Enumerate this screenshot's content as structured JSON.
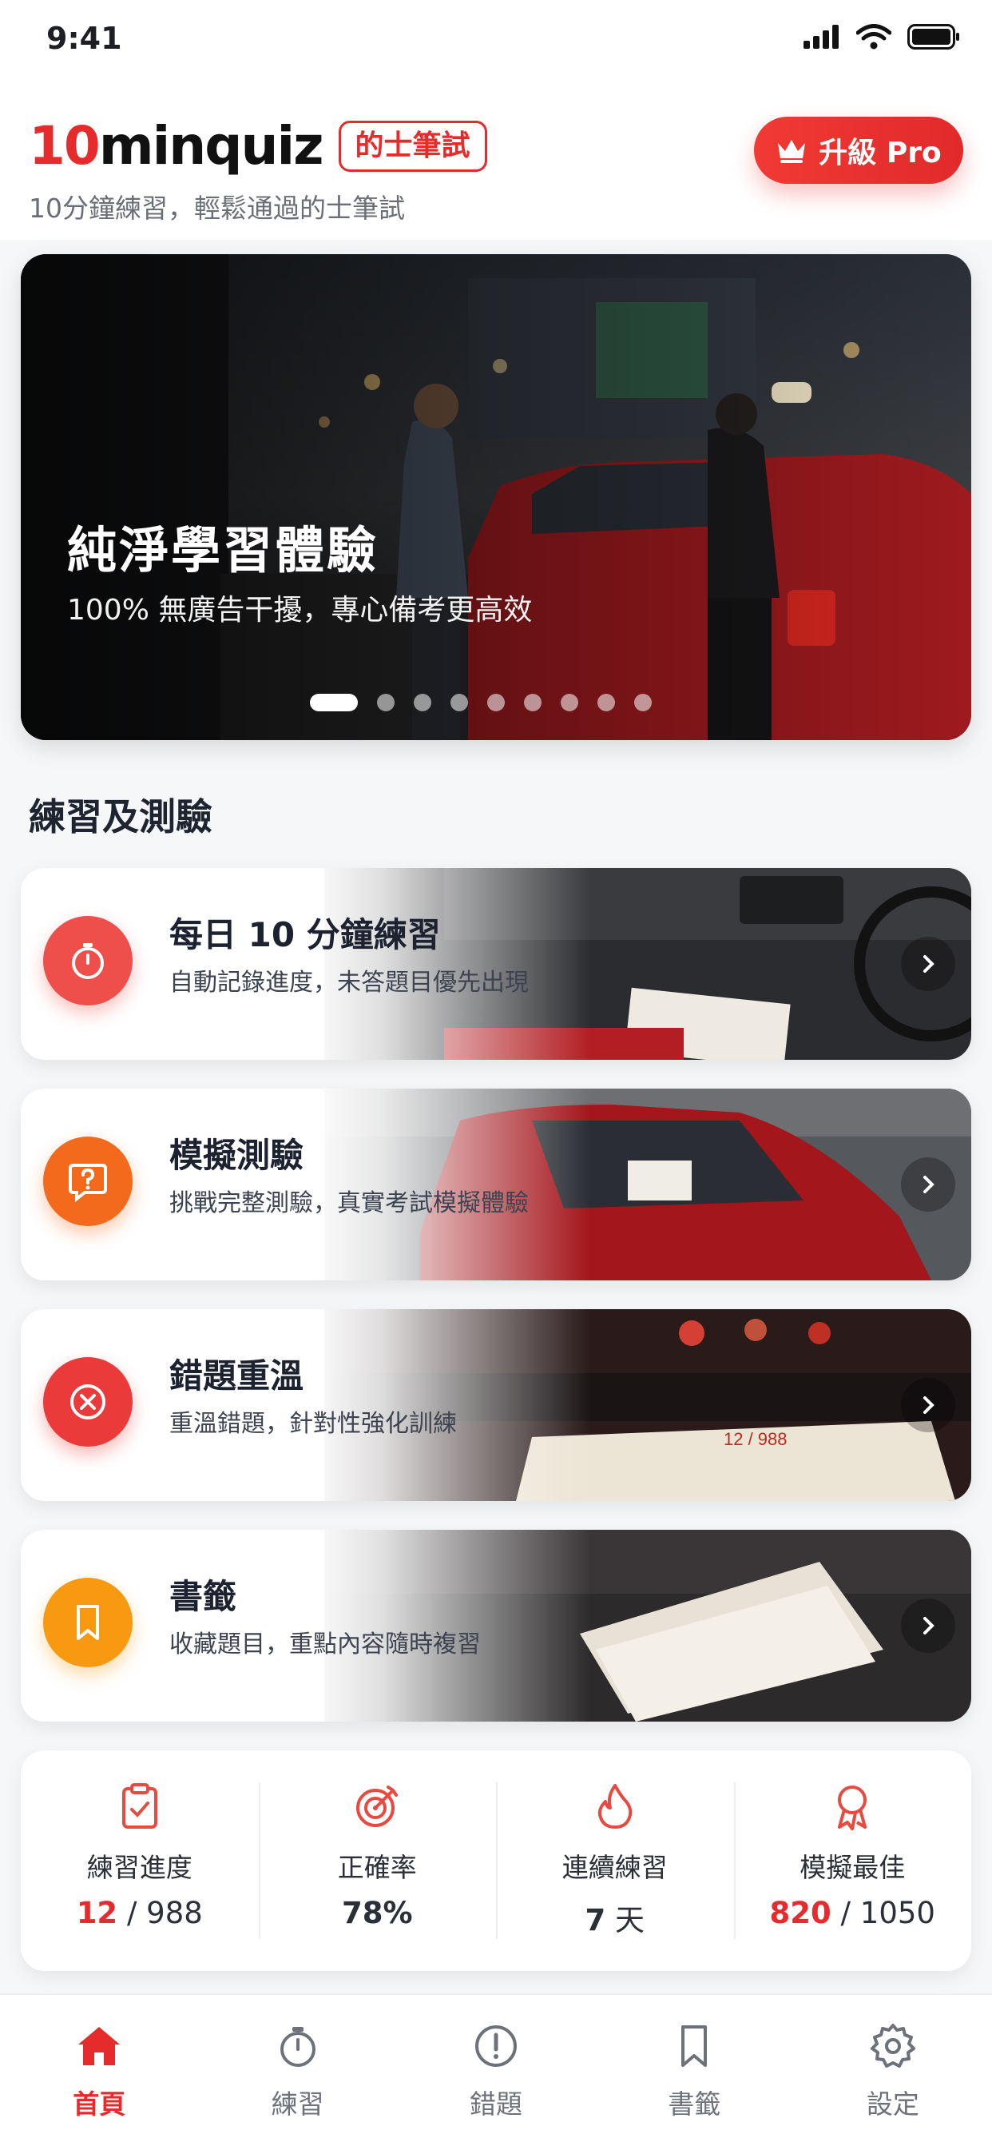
{
  "status_bar": {
    "time": "9:41"
  },
  "header": {
    "brand_prefix": "10",
    "brand_suffix": "minquiz",
    "tag": "的士筆試",
    "subtitle": "10分鐘練習，輕鬆通過的士筆試",
    "pro_button": "升級 Pro"
  },
  "hero": {
    "title": "純淨學習體驗",
    "subtitle": "100% 無廣告干擾，專心備考更高效",
    "slide_count": 9,
    "active_slide": 1
  },
  "section_title": "練習及測驗",
  "cards": [
    {
      "title": "每日 10 分鐘練習",
      "subtitle": "自動記錄進度，未答題目優先出現",
      "icon": "stopwatch-icon",
      "color": "#ef4f4a"
    },
    {
      "title": "模擬測驗",
      "subtitle": "挑戰完整測驗，真實考試模擬體驗",
      "icon": "question-bubble-icon",
      "color": "#f36a1d"
    },
    {
      "title": "錯題重溫",
      "subtitle": "重溫錯題，針對性強化訓練",
      "icon": "x-circle-icon",
      "color": "#ea3a3a"
    },
    {
      "title": "書籤",
      "subtitle": "收藏題目，重點內容隨時複習",
      "icon": "bookmark-icon",
      "color": "#f79a12"
    }
  ],
  "stats": {
    "progress": {
      "label": "練習進度",
      "value": "12",
      "total": "/ 988"
    },
    "accuracy": {
      "label": "正確率",
      "value": "78%"
    },
    "streak": {
      "label": "連續練習",
      "value": "7",
      "unit": "天"
    },
    "best": {
      "label": "模擬最佳",
      "value": "820",
      "total": "/ 1050"
    }
  },
  "tabs": [
    {
      "label": "首頁",
      "icon": "home-icon"
    },
    {
      "label": "練習",
      "icon": "stopwatch-icon"
    },
    {
      "label": "錯題",
      "icon": "alert-icon"
    },
    {
      "label": "書籤",
      "icon": "bookmark-icon"
    },
    {
      "label": "設定",
      "icon": "gear-icon"
    }
  ],
  "colors": {
    "accent": "#e52b2b"
  }
}
